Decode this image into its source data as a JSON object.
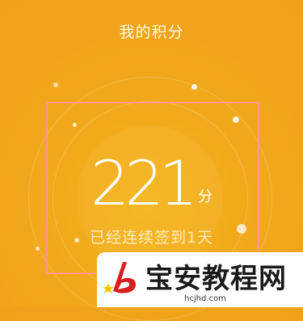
{
  "header": {
    "title": "我的积分"
  },
  "points": {
    "value": "221",
    "unit": "分"
  },
  "streak": {
    "text": "已经连续签到1天"
  },
  "watermark": {
    "name": "宝安教程网",
    "url": "hcjhd.com"
  },
  "colors": {
    "background": "#f2a91b",
    "text": "#ffffff",
    "selection": "#ff9696",
    "logo": "#d81e1e"
  }
}
